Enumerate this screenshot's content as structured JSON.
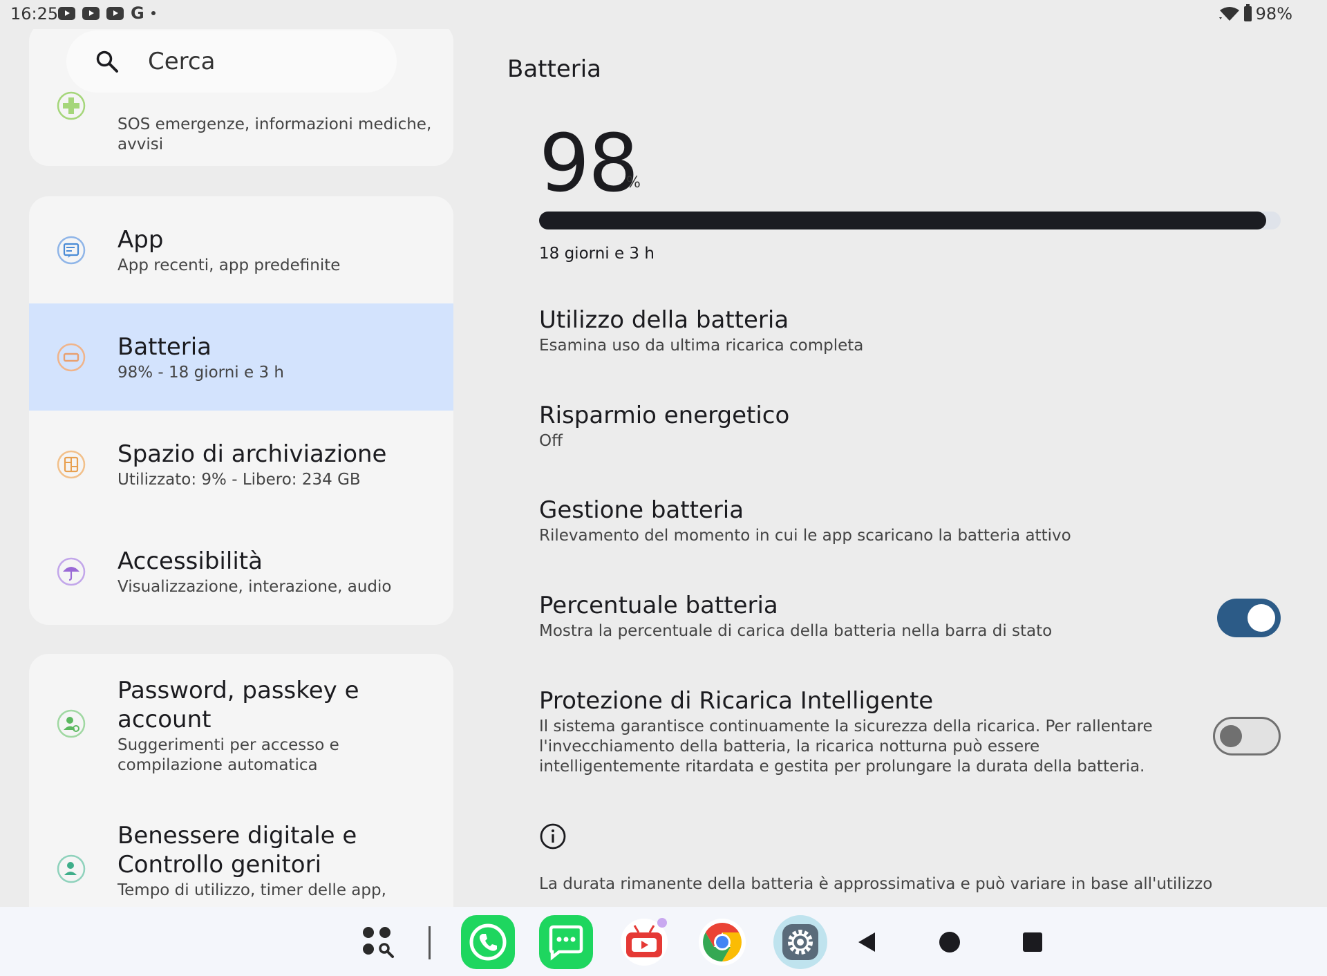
{
  "status_bar": {
    "time": "16:25",
    "left_icons": [
      "youtube-icon",
      "youtube-icon",
      "youtube-icon",
      "google-icon",
      "dot-icon"
    ],
    "battery_text": "98%",
    "right_icons": [
      "wifi-icon",
      "battery-icon"
    ]
  },
  "search": {
    "placeholder": "Cerca"
  },
  "sidebar": {
    "card1": {
      "items": [
        {
          "subtitle": "SOS emergenze, informazioni mediche, avvisi",
          "icon": "emergency-icon",
          "color": "#8bc34a"
        }
      ]
    },
    "card2": {
      "items": [
        {
          "title": "App",
          "subtitle": "App recenti, app predefinite",
          "icon": "apps-icon",
          "color": "#4a8bd6"
        },
        {
          "title": "Batteria",
          "subtitle": "98% - 18 giorni e 3 h",
          "icon": "battery-icon",
          "color": "#e8a070",
          "selected": true
        },
        {
          "title": "Spazio di archiviazione",
          "subtitle": "Utilizzato: 9% - Libero: 234 GB",
          "icon": "storage-icon",
          "color": "#e8a050"
        },
        {
          "title": "Accessibilità",
          "subtitle": "Visualizzazione, interazione, audio",
          "icon": "accessibility-icon",
          "color": "#9a6ad6"
        }
      ]
    },
    "card3": {
      "items": [
        {
          "title": "Password, passkey e account",
          "subtitle": "Suggerimenti per accesso e compilazione automatica",
          "icon": "account-icon",
          "color": "#5cb860"
        },
        {
          "title": "Benessere digitale e Controllo genitori",
          "subtitle": "Tempo di utilizzo, timer delle app,",
          "icon": "wellbeing-icon",
          "color": "#3fae8a"
        }
      ]
    }
  },
  "battery_page": {
    "title": "Batteria",
    "percent": "98",
    "percent_sign": "%",
    "level_fraction": 0.98,
    "remaining": "18 giorni e 3 h",
    "settings": [
      {
        "title": "Utilizzo della batteria",
        "subtitle": "Esamina uso da ultima ricarica completa"
      },
      {
        "title": "Risparmio energetico",
        "subtitle": "Off"
      },
      {
        "title": "Gestione batteria",
        "subtitle": "Rilevamento del momento in cui le app scaricano la batteria attivo"
      },
      {
        "title": "Percentuale batteria",
        "subtitle": "Mostra la percentuale di carica della batteria nella barra di stato",
        "toggle": "on"
      },
      {
        "title": "Protezione di Ricarica Intelligente",
        "subtitle": "Il sistema garantisce continuamente la sicurezza della ricarica. Per rallentare l'invecchiamento della batteria, la ricarica notturna può essere intelligentemente ritardata e gestita per prolungare la durata della batteria.",
        "toggle": "off"
      }
    ],
    "footnote": "La durata rimanente della batteria è approssimativa e può variare in base all'utilizzo"
  },
  "taskbar": {
    "items": [
      "app-drawer-icon",
      "phone-app-icon",
      "messages-app-icon",
      "tv-app-icon",
      "chrome-app-icon",
      "settings-app-icon",
      "back-icon",
      "home-icon",
      "recents-icon"
    ],
    "colors": {
      "phone": "#1ed65f",
      "messages": "#1ed65f",
      "tv": "#e53935",
      "settings": "#5a6b7a",
      "toggle_on": "#2c5b87",
      "selected_bg": "#d3e3fd"
    }
  }
}
